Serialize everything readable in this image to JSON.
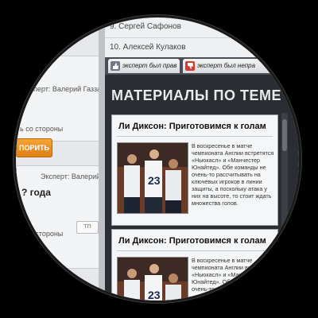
{
  "left": {
    "card1": {
      "line1": "Эксперт: Валерий Газзаев",
      "line2": "ь со стороны",
      "vote_label": "ПОРИТЬ"
    },
    "card2": {
      "expert": "Эксперт: Валерий Газзаев",
      "heading": "? года",
      "line1": "ь со стороны",
      "logo": "ТП"
    }
  },
  "top_list": {
    "item1": "9. Сергей Сафонов",
    "item2": "10. Алексей Кулаков"
  },
  "tabs": [
    {
      "label": "эксперт был прав"
    },
    {
      "label": "эксперт был непра"
    }
  ],
  "section_title": "МАТЕРИАЛЫ ПО ТЕМЕ",
  "articles": [
    {
      "title": "Ли Диксон: Приготовимся к голам",
      "text_lines": [
        "В воскресенье в матче",
        "чемпионата Англии встретятся",
        "«Ньюкасл» и «Манчестер",
        "Юнайтед». Обе команды не",
        "очень-то рассчитывать на",
        "ключевых игроков в линии",
        "защиты, а поскольку атака у",
        "них на высоте, то стоит ждать",
        "множества голов."
      ]
    },
    {
      "title": "Ли Диксон: Приготовимся к голам",
      "text_lines": [
        "В воскресенье в матче",
        "чемпионата Англии встретятся",
        "«Ньюкасл» и «Манчестер",
        "Юнайтед». Обе команды не",
        "очень-то рассчитывать на"
      ]
    }
  ],
  "colors": {
    "accent_orange": "#e8871a",
    "section_bg": "#2a2d31",
    "tab_red": "#d83a2e"
  }
}
